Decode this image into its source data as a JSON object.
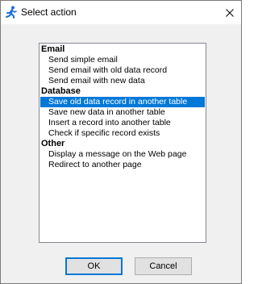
{
  "window": {
    "title": "Select action",
    "app_icon": "running-man-icon",
    "close_icon": "close-icon"
  },
  "list": {
    "selected_color": "#0078d7",
    "groups": [
      {
        "label": "Email",
        "items": [
          "Send simple email",
          "Send email with old data record",
          "Send email with new data"
        ]
      },
      {
        "label": "Database",
        "items": [
          "Save old data record in another table",
          "Save new data in another table",
          "Insert a record into another table",
          "Check if specific record exists"
        ]
      },
      {
        "label": "Other",
        "items": [
          "Display a message on the Web page",
          "Redirect to another page"
        ]
      }
    ],
    "selected_item": "Save old data record in another table"
  },
  "buttons": {
    "ok_label": "OK",
    "cancel_label": "Cancel"
  }
}
